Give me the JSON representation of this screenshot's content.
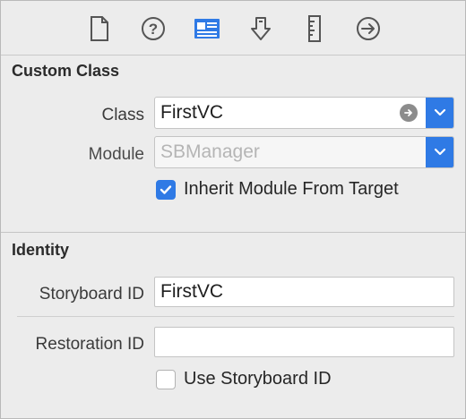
{
  "toolbar": {
    "icons": [
      {
        "name": "file-inspector-icon"
      },
      {
        "name": "quick-help-icon"
      },
      {
        "name": "identity-inspector-icon",
        "selected": true
      },
      {
        "name": "attributes-inspector-icon"
      },
      {
        "name": "size-inspector-icon"
      },
      {
        "name": "connections-inspector-icon"
      }
    ],
    "accent_color": "#2f7ae5"
  },
  "custom_class": {
    "title": "Custom Class",
    "class_label": "Class",
    "class_value": "FirstVC",
    "module_label": "Module",
    "module_placeholder": "SBManager",
    "inherit_label": "Inherit Module From Target",
    "inherit_checked": true
  },
  "identity": {
    "title": "Identity",
    "storyboard_id_label": "Storyboard ID",
    "storyboard_id_value": "FirstVC",
    "restoration_id_label": "Restoration ID",
    "restoration_id_value": "",
    "use_storyboard_id_label": "Use Storyboard ID",
    "use_storyboard_id_checked": false
  }
}
